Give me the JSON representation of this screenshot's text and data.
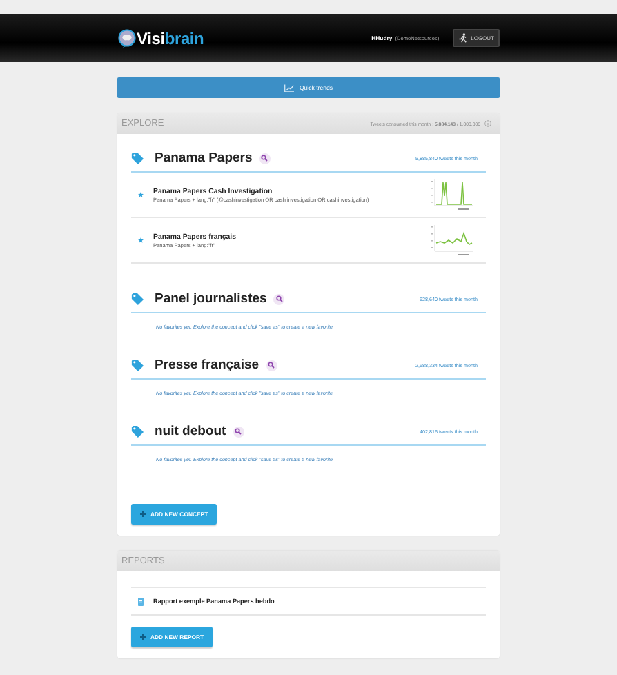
{
  "header": {
    "logo": {
      "first": "Visi",
      "second": "brain"
    },
    "user": "HHudry",
    "account": "(DemoNetsources)",
    "logout": "LOGOUT"
  },
  "quick_trends": {
    "label": "Quick trends"
  },
  "explore": {
    "title": "EXPLORE",
    "usage": "Tweets consumed this month : **5,884,143** / 1,000,000",
    "concepts": [
      {
        "name": "Panama Papers",
        "count": "5,885,840 tweets this month",
        "favorites": [
          {
            "title": "Panama Papers Cash Investigation",
            "query": "Panama Papers + lang:\"fr\" (@cashinvestigation OR cash investigation OR cashinvestigation)"
          },
          {
            "title": "Panama Papers français",
            "query": "Panama Papers + lang:\"fr\""
          }
        ]
      },
      {
        "name": "Panel journalistes",
        "count": "628,640 tweets this month",
        "empty_message": "No favorites yet. Explore the concept and click \"save as\" to create a new favorite"
      },
      {
        "name": "Presse française",
        "count": "2,688,334 tweets this month",
        "empty_message": "No favorites yet. Explore the concept and click \"save as\" to create a new favorite"
      },
      {
        "name": "nuit debout",
        "count": "402,816 tweets this month",
        "empty_message": "No favorites yet. Explore the concept and click \"save as\" to create a new favorite"
      }
    ],
    "add_button": "ADD NEW CONCEPT"
  },
  "reports": {
    "title": "REPORTS",
    "items": [
      {
        "title": "Rapport exemple Panama Papers hebdo"
      }
    ],
    "add_button": "ADD NEW REPORT"
  }
}
